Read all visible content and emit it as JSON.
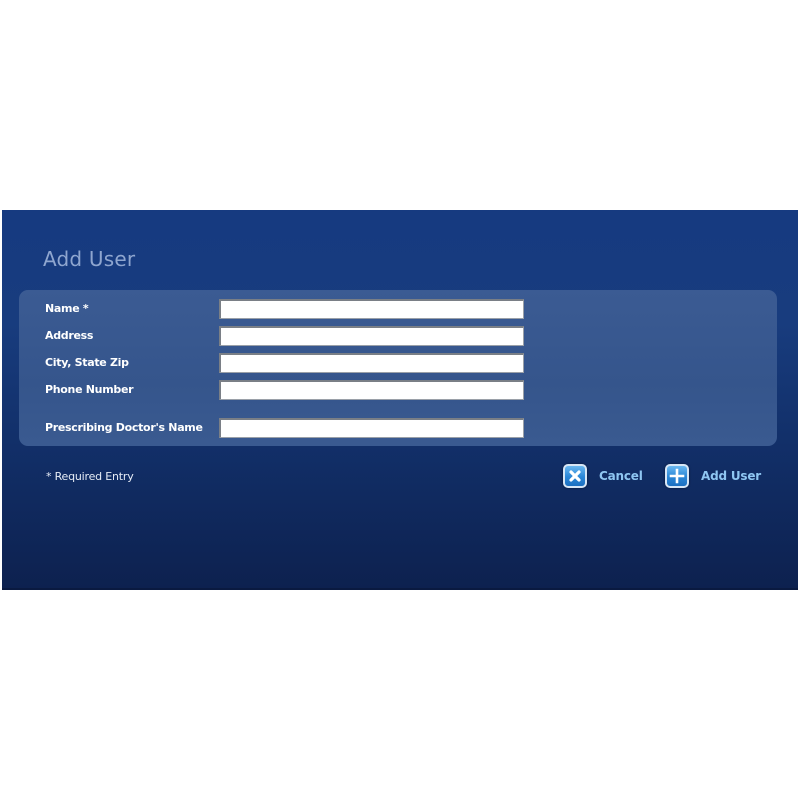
{
  "dialog": {
    "title": "Add User"
  },
  "form": {
    "fields": [
      {
        "label": "Name *",
        "value": ""
      },
      {
        "label": "Address",
        "value": ""
      },
      {
        "label": "City, State Zip",
        "value": ""
      },
      {
        "label": "Phone Number",
        "value": ""
      },
      {
        "label": "Prescribing Doctor's Name",
        "value": ""
      }
    ]
  },
  "footer": {
    "required_note": "* Required Entry",
    "cancel_label": "Cancel",
    "cancel_icon": "close-icon",
    "add_user_label": "Add User",
    "add_user_icon": "plus-icon"
  },
  "colors": {
    "panel_bg": "#163a80",
    "form_box_bg": "#3b5b93",
    "title_text": "#8fa6cf",
    "button_text": "#8fc6f2",
    "icon_blue": "#2a86d6"
  }
}
